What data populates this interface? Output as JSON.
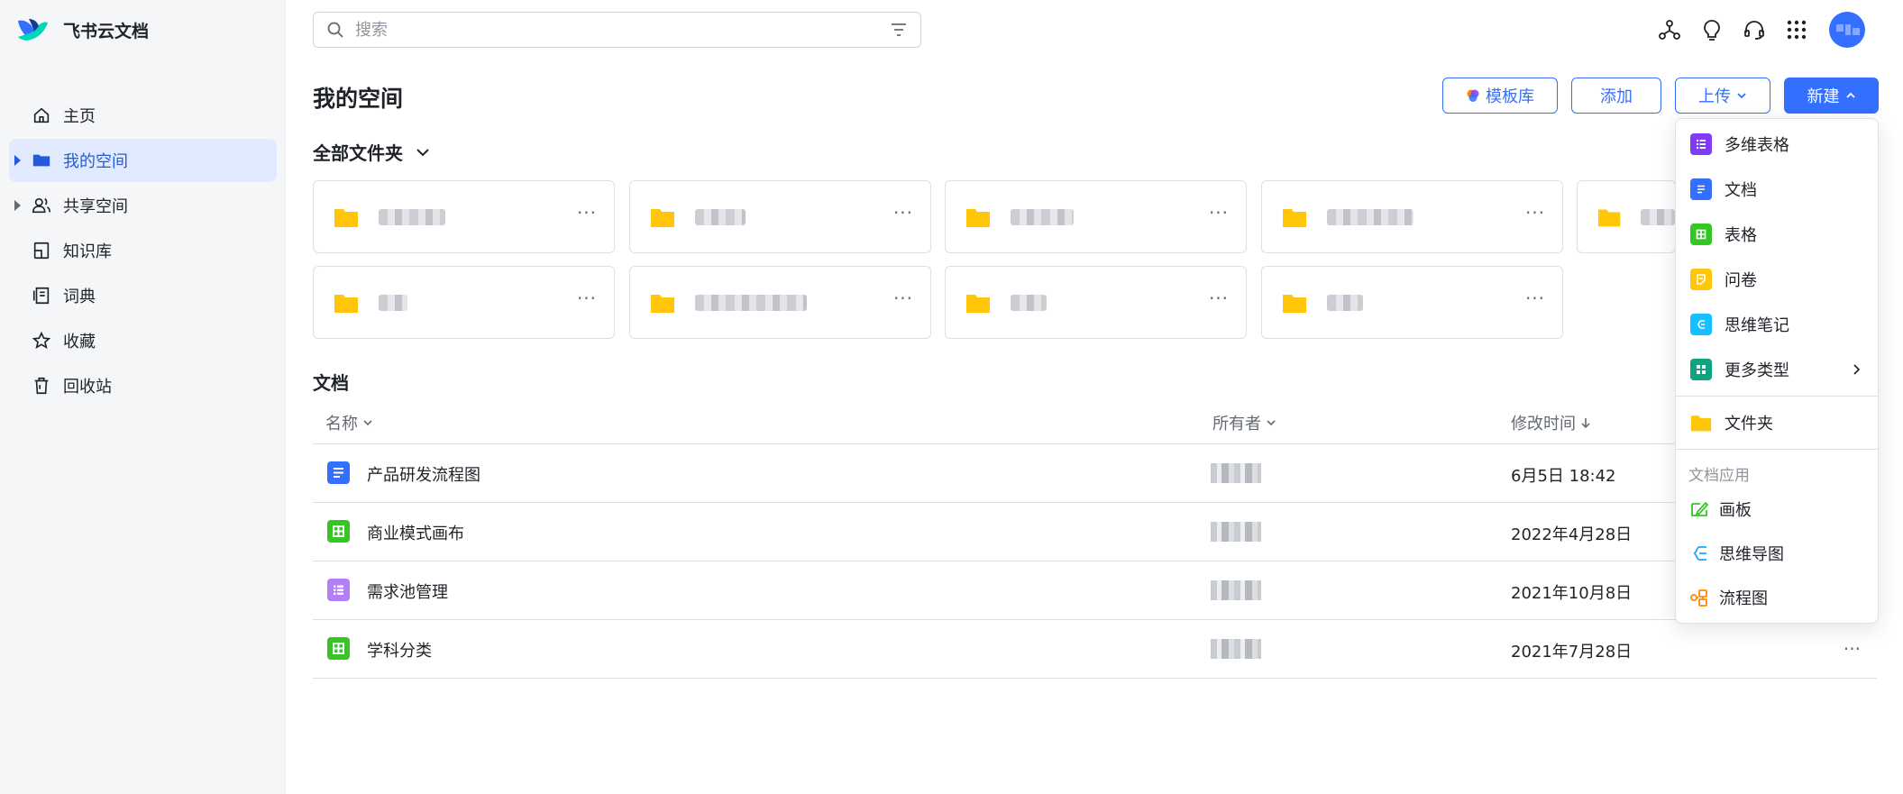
{
  "brand": {
    "name": "飞书云文档"
  },
  "sidebar": {
    "items": [
      {
        "label": "主页",
        "icon": "home-icon"
      },
      {
        "label": "我的空间",
        "icon": "folder-icon",
        "active": true
      },
      {
        "label": "共享空间",
        "icon": "users-icon"
      },
      {
        "label": "知识库",
        "icon": "book-icon"
      },
      {
        "label": "词典",
        "icon": "dictionary-icon"
      },
      {
        "label": "收藏",
        "icon": "star-icon"
      },
      {
        "label": "回收站",
        "icon": "trash-icon"
      }
    ]
  },
  "search": {
    "placeholder": "搜索"
  },
  "header": {
    "title": "我的空间"
  },
  "actions": {
    "template": "模板库",
    "add": "添加",
    "upload": "上传",
    "new": "新建"
  },
  "folders": {
    "heading": "全部文件夹"
  },
  "docs": {
    "heading": "文档",
    "columns": {
      "name": "名称",
      "owner": "所有者",
      "modified": "修改时间"
    },
    "rows": [
      {
        "name": "产品研发流程图",
        "type": "doc",
        "time": "6月5日 18:42"
      },
      {
        "name": "商业模式画布",
        "type": "sheet",
        "time": "2022年4月28日"
      },
      {
        "name": "需求池管理",
        "type": "bitable",
        "time": "2021年10月8日"
      },
      {
        "name": "学科分类",
        "type": "sheet",
        "time": "2021年7月28日"
      }
    ]
  },
  "new_menu": {
    "items": [
      {
        "label": "多维表格",
        "icon": "bitable-icon",
        "color": "#7f3bf5"
      },
      {
        "label": "文档",
        "icon": "doc-icon",
        "color": "#3370ff"
      },
      {
        "label": "表格",
        "icon": "sheet-icon",
        "color": "#34c724"
      },
      {
        "label": "问卷",
        "icon": "survey-icon",
        "color": "#ffc60a"
      },
      {
        "label": "思维笔记",
        "icon": "mindnote-icon",
        "color": "#14c0ff"
      },
      {
        "label": "更多类型",
        "icon": "more-types-icon",
        "color": "#10a37f"
      }
    ],
    "folder": "文件夹",
    "apps_label": "文档应用",
    "apps": [
      {
        "label": "画板",
        "icon": "whiteboard-icon",
        "color": "#34c724"
      },
      {
        "label": "思维导图",
        "icon": "mindmap-icon",
        "color": "#14a9ff"
      },
      {
        "label": "流程图",
        "icon": "flowchart-icon",
        "color": "#ff8800"
      }
    ]
  }
}
